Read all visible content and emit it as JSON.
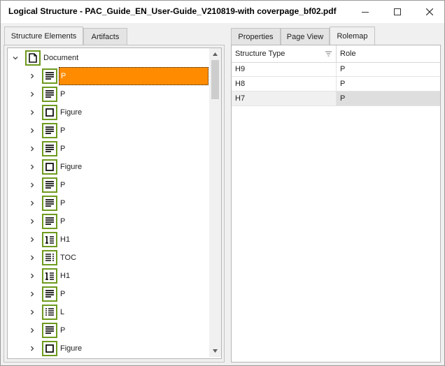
{
  "window": {
    "title": "Logical Structure - PAC_Guide_EN_User-Guide_V210819-with coverpage_bf02.pdf"
  },
  "left_tabs": [
    "Structure Elements",
    "Artifacts"
  ],
  "right_tabs": [
    "Properties",
    "Page View",
    "Rolemap"
  ],
  "tree": {
    "root": {
      "label": "Document",
      "icon": "document-icon"
    },
    "children": [
      {
        "label": "P",
        "icon": "paragraph-icon",
        "selected": true
      },
      {
        "label": "P",
        "icon": "paragraph-icon"
      },
      {
        "label": "Figure",
        "icon": "figure-icon"
      },
      {
        "label": "P",
        "icon": "paragraph-icon"
      },
      {
        "label": "P",
        "icon": "paragraph-icon"
      },
      {
        "label": "Figure",
        "icon": "figure-icon"
      },
      {
        "label": "P",
        "icon": "paragraph-icon"
      },
      {
        "label": "P",
        "icon": "paragraph-icon"
      },
      {
        "label": "P",
        "icon": "paragraph-icon"
      },
      {
        "label": "H1",
        "icon": "heading-icon"
      },
      {
        "label": "TOC",
        "icon": "toc-icon"
      },
      {
        "label": "H1",
        "icon": "heading-icon"
      },
      {
        "label": "P",
        "icon": "paragraph-icon"
      },
      {
        "label": "L",
        "icon": "list-icon"
      },
      {
        "label": "P",
        "icon": "paragraph-icon"
      },
      {
        "label": "Figure",
        "icon": "figure-icon"
      }
    ]
  },
  "rolemap": {
    "columns": [
      "Structure Type",
      "Role"
    ],
    "rows": [
      {
        "type": "H9",
        "role": "P"
      },
      {
        "type": "H8",
        "role": "P"
      },
      {
        "type": "H7",
        "role": "P"
      }
    ]
  },
  "colors": {
    "accent": "#ff8c00",
    "icon_border": "#6e9a1e"
  }
}
